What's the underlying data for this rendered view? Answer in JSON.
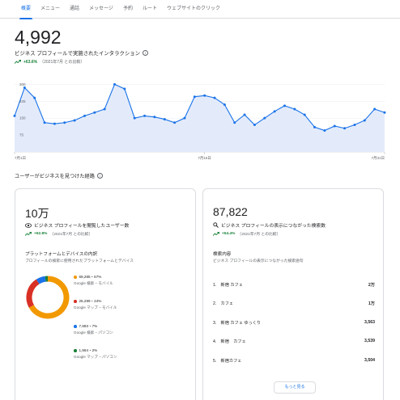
{
  "tabs": [
    {
      "label": "概要",
      "active": true
    },
    {
      "label": "メニュー",
      "active": false
    },
    {
      "label": "通話",
      "active": false
    },
    {
      "label": "メッセージ",
      "active": false
    },
    {
      "label": "予約",
      "active": false
    },
    {
      "label": "ルート",
      "active": false
    },
    {
      "label": "ウェブサイトのクリック",
      "active": false
    }
  ],
  "summary": {
    "total": "4,992",
    "label": "ビジネス プロフィールで実施されたインタラクション",
    "info_icon": "i",
    "change": "+63.6%",
    "compare": "（2021年7月 との比較）"
  },
  "chart_data": {
    "type": "area",
    "y_ticks": [
      "75",
      "150",
      "225",
      "300"
    ],
    "x_ticks": [
      "7月1日",
      "7月16日",
      "7月31日"
    ],
    "values": [
      160,
      285,
      240,
      130,
      125,
      130,
      140,
      160,
      175,
      190,
      300,
      280,
      150,
      160,
      155,
      145,
      130,
      150,
      245,
      250,
      240,
      210,
      130,
      165,
      120,
      150,
      180,
      205,
      190,
      165,
      110,
      95,
      115,
      105,
      120,
      140,
      190,
      175
    ],
    "color": "#1a73e8",
    "fill": "#e3ebfb"
  },
  "discovery": {
    "title": "ユーザーがビジネスを見つけた経路",
    "info_icon": "i"
  },
  "views_card": {
    "total": "10万",
    "label": "ビジネス プロフィールを閲覧したユーザー数",
    "icon": "eye-icon",
    "change": "+52.8%",
    "compare": "（2021年7月 との比較）",
    "breakdown_title": "プラットフォームとデバイスの内訳",
    "breakdown_desc": "プロフィールの検索に使用されたプラットフォームとデバイス",
    "segments": [
      {
        "value": "69,285・67%",
        "name": "Google 検索 – モバイル",
        "color": "#f29900",
        "fraction": 0.67
      },
      {
        "value": "25,299・24%",
        "name": "Google マップ – モバイル",
        "color": "#d93025",
        "fraction": 0.24
      },
      {
        "value": "7,683・7%",
        "name": "Google 検索 – パソコン",
        "color": "#1a73e8",
        "fraction": 0.07
      },
      {
        "value": "1,564・2%",
        "name": "Google マップ – パソコン",
        "color": "#188038",
        "fraction": 0.02
      }
    ]
  },
  "search_card": {
    "total": "87,822",
    "label": "ビジネス プロフィールの表示につながった検索数",
    "icon": "search-icon",
    "change": "+54.4%",
    "compare": "（2021年7月 との比較）",
    "keywords_title": "検索内容",
    "keywords_desc": "ビジネス プロフィールの表示につながった検索語句",
    "keywords": [
      {
        "term": "1.　新宿 カフェ",
        "count": "2万"
      },
      {
        "term": "2.　カフェ",
        "count": "1万"
      },
      {
        "term": "3.　新宿 カフェ ゆっくり",
        "count": "3,563"
      },
      {
        "term": "4.　新宿　カフェ",
        "count": "3,539"
      },
      {
        "term": "5.　新宿カフェ",
        "count": "3,504"
      }
    ],
    "more_label": "もっと見る"
  }
}
